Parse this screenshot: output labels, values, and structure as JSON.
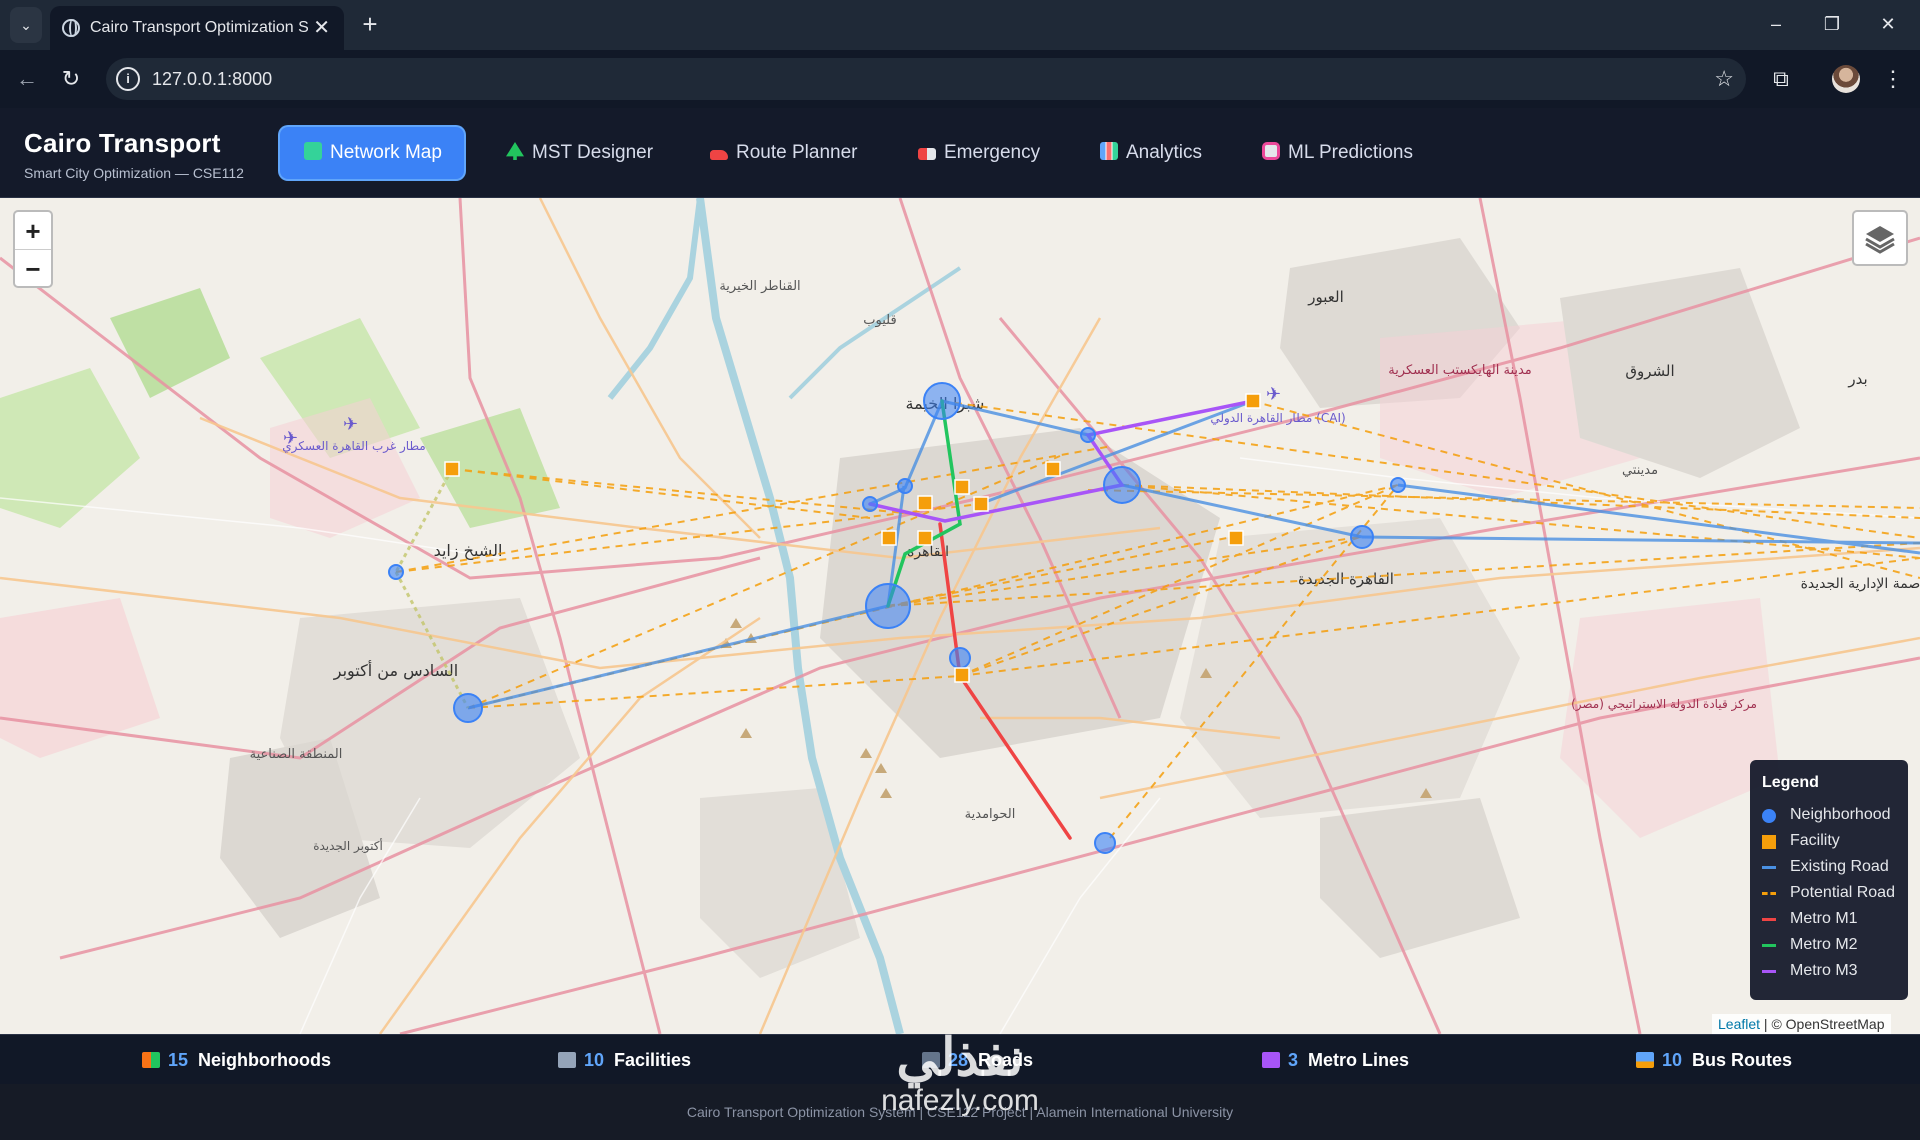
{
  "browser": {
    "tab_title": "Cairo Transport Optimization Sy",
    "url": "127.0.0.1:8000"
  },
  "app": {
    "brand": "Cairo Transport",
    "subtitle": "Smart City Optimization — CSE112",
    "nav": [
      {
        "label": "Network Map",
        "icon": "map-icon",
        "active": true
      },
      {
        "label": "MST Designer",
        "icon": "tree-icon"
      },
      {
        "label": "Route Planner",
        "icon": "car-icon"
      },
      {
        "label": "Emergency",
        "icon": "ambulance-icon"
      },
      {
        "label": "Analytics",
        "icon": "chart-icon"
      },
      {
        "label": "ML Predictions",
        "icon": "robot-icon"
      }
    ]
  },
  "map": {
    "zoom_in": "+",
    "zoom_out": "−",
    "legend_title": "Legend",
    "legend": [
      {
        "label": "Neighborhood",
        "kind": "dot",
        "color": "#3b82f6"
      },
      {
        "label": "Facility",
        "kind": "square",
        "color": "#f59e0b"
      },
      {
        "label": "Existing Road",
        "kind": "line",
        "color": "#4a90e2"
      },
      {
        "label": "Potential Road",
        "kind": "dash",
        "color": "#f59e0b"
      },
      {
        "label": "Metro M1",
        "kind": "line",
        "color": "#ef4444"
      },
      {
        "label": "Metro M2",
        "kind": "line",
        "color": "#22c55e"
      },
      {
        "label": "Metro M3",
        "kind": "line",
        "color": "#a855f7"
      }
    ],
    "attribution_leaflet": "Leaflet",
    "attribution_rest": " | © OpenStreetMap",
    "place_labels": [
      "القناطر الخيرية",
      "قليوب",
      "شبرا الخيمة",
      "العبور",
      "الشروق",
      "بدر",
      "مدينة الهايكستب العسكرية",
      "مطار القاهرة الدولي (CAI)",
      "مدينتي",
      "الشيخ زايد",
      "السادس من أكتوبر",
      "المنطقة الصناعية",
      "أكتوبر الجديدة",
      "القاهرة الجديدة",
      "مركز قيادة الدولة الاستراتيجي (مصر)",
      "الحوامدية",
      "مطار غرب القاهرة العسكري",
      "العاصمة الإدارية الجديدة",
      "القاهرة"
    ]
  },
  "stats": [
    {
      "value": "15",
      "label": "Neighborhoods",
      "icon": "houses-icon"
    },
    {
      "value": "10",
      "label": "Facilities",
      "icon": "building-icon"
    },
    {
      "value": "28",
      "label": "Roads",
      "icon": "road-icon"
    },
    {
      "value": "3",
      "label": "Metro Lines",
      "icon": "metro-icon"
    },
    {
      "value": "10",
      "label": "Bus Routes",
      "icon": "bus-icon"
    }
  ],
  "footer": "Cairo Transport Optimization System | CSE112 Project | Alamein International University",
  "watermark": {
    "ar": "نفذلي",
    "en": "nafezly.com"
  },
  "colors": {
    "accent": "#3b82f6",
    "metro_m1": "#ef4444",
    "metro_m2": "#22c55e",
    "metro_m3": "#a855f7",
    "facility": "#f59e0b"
  }
}
